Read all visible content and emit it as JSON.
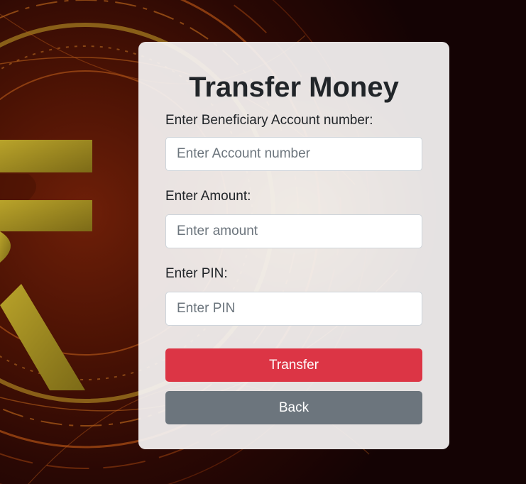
{
  "form": {
    "title": "Transfer Money",
    "account": {
      "label": "Enter Beneficiary Account number:",
      "placeholder": "Enter Account number",
      "value": ""
    },
    "amount": {
      "label": "Enter Amount:",
      "placeholder": "Enter amount",
      "value": ""
    },
    "pin": {
      "label": "Enter PIN:",
      "placeholder": "Enter PIN",
      "value": ""
    },
    "transfer_label": "Transfer",
    "back_label": "Back"
  },
  "background": {
    "icon": "rupee-symbol",
    "symbol": "₹"
  },
  "colors": {
    "transfer_button": "#dc3545",
    "back_button": "#6c757d",
    "card_bg": "#f5f3f3",
    "text": "#212529"
  }
}
